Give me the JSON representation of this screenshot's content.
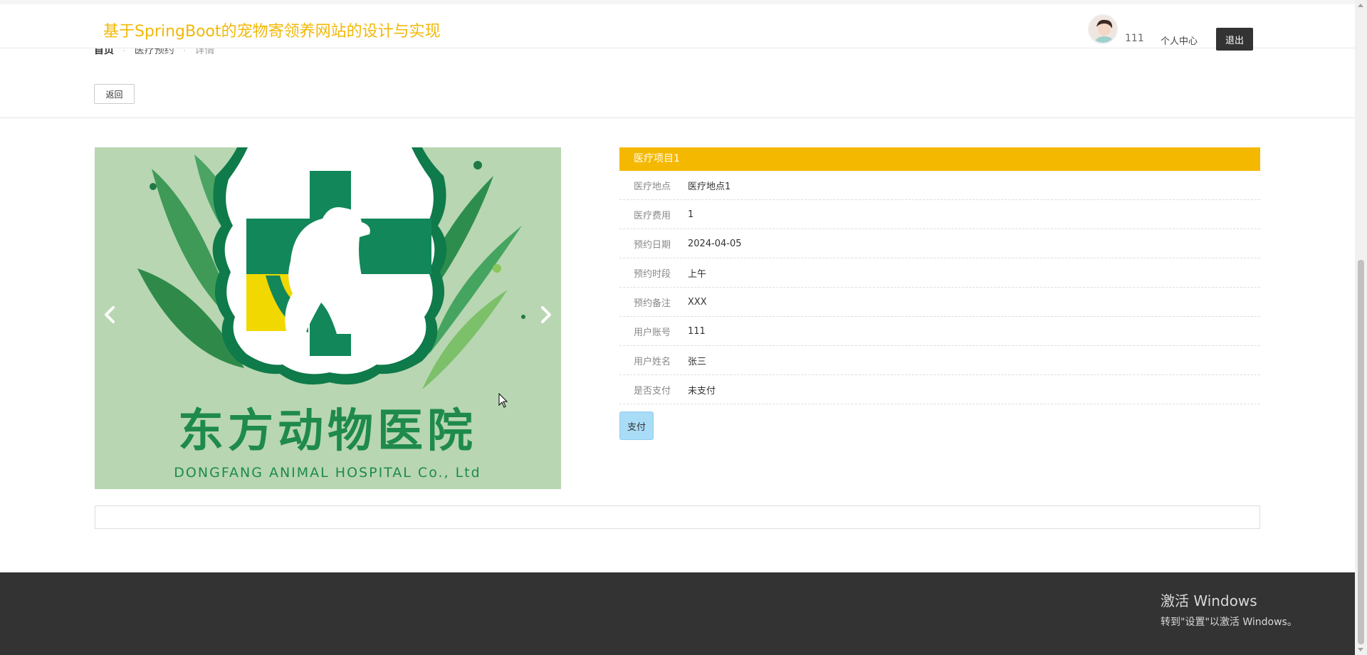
{
  "header": {
    "site_title": "基于SpringBoot的宠物寄领养网站的设计与实现",
    "username": "111",
    "user_center_label": "个人中心",
    "logout_label": "退出"
  },
  "breadcrumb": {
    "items": [
      "首页",
      "医疗预约",
      "详情"
    ],
    "separator": ":"
  },
  "actions": {
    "back_label": "返回",
    "pay_label": "支付"
  },
  "carousel": {
    "logo_text_cn": "东方动物医院",
    "logo_text_en": "DONGFANG ANIMAL HOSPITAL Co., Ltd",
    "colors": {
      "background": "#b8d6b2",
      "cross": "#14885c",
      "accent": "#f0d800"
    }
  },
  "detail": {
    "title": "医疗项目1",
    "rows": [
      {
        "label": "医疗地点",
        "value": "医疗地点1"
      },
      {
        "label": "医疗费用",
        "value": "1"
      },
      {
        "label": "预约日期",
        "value": "2024-04-05"
      },
      {
        "label": "预约时段",
        "value": "上午"
      },
      {
        "label": "预约备注",
        "value": "XXX"
      },
      {
        "label": "用户账号",
        "value": "111"
      },
      {
        "label": "用户姓名",
        "value": "张三"
      },
      {
        "label": "是否支付",
        "value": "未支付"
      }
    ]
  },
  "watermark": {
    "line1": "激活 Windows",
    "line2": "转到\"设置\"以激活 Windows。"
  },
  "colors": {
    "brand": "#f2b807",
    "title_bar": "#f5b800",
    "pay_button": "#a9dcf7",
    "footer": "#333333"
  }
}
